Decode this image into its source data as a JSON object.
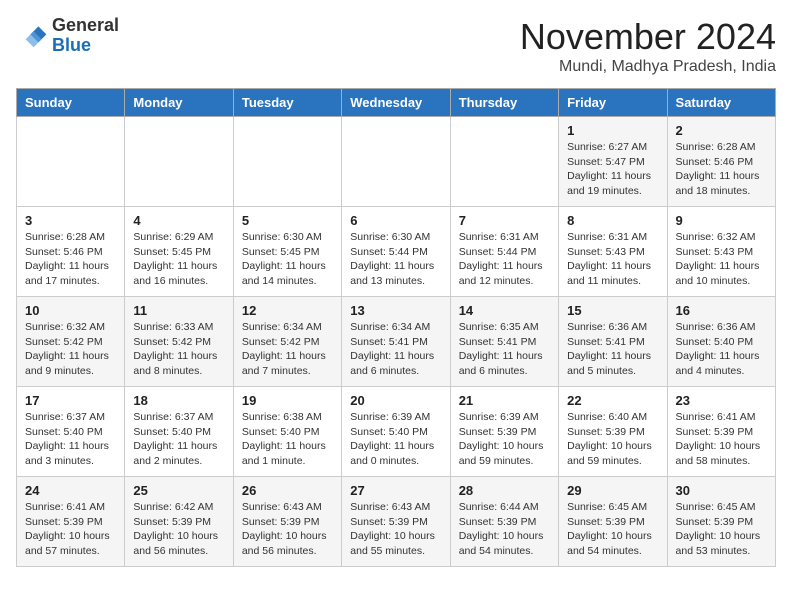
{
  "header": {
    "logo_general": "General",
    "logo_blue": "Blue",
    "month_title": "November 2024",
    "subtitle": "Mundi, Madhya Pradesh, India"
  },
  "days_of_week": [
    "Sunday",
    "Monday",
    "Tuesday",
    "Wednesday",
    "Thursday",
    "Friday",
    "Saturday"
  ],
  "weeks": [
    [
      {
        "day": "",
        "info": ""
      },
      {
        "day": "",
        "info": ""
      },
      {
        "day": "",
        "info": ""
      },
      {
        "day": "",
        "info": ""
      },
      {
        "day": "",
        "info": ""
      },
      {
        "day": "1",
        "info": "Sunrise: 6:27 AM\nSunset: 5:47 PM\nDaylight: 11 hours and 19 minutes."
      },
      {
        "day": "2",
        "info": "Sunrise: 6:28 AM\nSunset: 5:46 PM\nDaylight: 11 hours and 18 minutes."
      }
    ],
    [
      {
        "day": "3",
        "info": "Sunrise: 6:28 AM\nSunset: 5:46 PM\nDaylight: 11 hours and 17 minutes."
      },
      {
        "day": "4",
        "info": "Sunrise: 6:29 AM\nSunset: 5:45 PM\nDaylight: 11 hours and 16 minutes."
      },
      {
        "day": "5",
        "info": "Sunrise: 6:30 AM\nSunset: 5:45 PM\nDaylight: 11 hours and 14 minutes."
      },
      {
        "day": "6",
        "info": "Sunrise: 6:30 AM\nSunset: 5:44 PM\nDaylight: 11 hours and 13 minutes."
      },
      {
        "day": "7",
        "info": "Sunrise: 6:31 AM\nSunset: 5:44 PM\nDaylight: 11 hours and 12 minutes."
      },
      {
        "day": "8",
        "info": "Sunrise: 6:31 AM\nSunset: 5:43 PM\nDaylight: 11 hours and 11 minutes."
      },
      {
        "day": "9",
        "info": "Sunrise: 6:32 AM\nSunset: 5:43 PM\nDaylight: 11 hours and 10 minutes."
      }
    ],
    [
      {
        "day": "10",
        "info": "Sunrise: 6:32 AM\nSunset: 5:42 PM\nDaylight: 11 hours and 9 minutes."
      },
      {
        "day": "11",
        "info": "Sunrise: 6:33 AM\nSunset: 5:42 PM\nDaylight: 11 hours and 8 minutes."
      },
      {
        "day": "12",
        "info": "Sunrise: 6:34 AM\nSunset: 5:42 PM\nDaylight: 11 hours and 7 minutes."
      },
      {
        "day": "13",
        "info": "Sunrise: 6:34 AM\nSunset: 5:41 PM\nDaylight: 11 hours and 6 minutes."
      },
      {
        "day": "14",
        "info": "Sunrise: 6:35 AM\nSunset: 5:41 PM\nDaylight: 11 hours and 6 minutes."
      },
      {
        "day": "15",
        "info": "Sunrise: 6:36 AM\nSunset: 5:41 PM\nDaylight: 11 hours and 5 minutes."
      },
      {
        "day": "16",
        "info": "Sunrise: 6:36 AM\nSunset: 5:40 PM\nDaylight: 11 hours and 4 minutes."
      }
    ],
    [
      {
        "day": "17",
        "info": "Sunrise: 6:37 AM\nSunset: 5:40 PM\nDaylight: 11 hours and 3 minutes."
      },
      {
        "day": "18",
        "info": "Sunrise: 6:37 AM\nSunset: 5:40 PM\nDaylight: 11 hours and 2 minutes."
      },
      {
        "day": "19",
        "info": "Sunrise: 6:38 AM\nSunset: 5:40 PM\nDaylight: 11 hours and 1 minute."
      },
      {
        "day": "20",
        "info": "Sunrise: 6:39 AM\nSunset: 5:40 PM\nDaylight: 11 hours and 0 minutes."
      },
      {
        "day": "21",
        "info": "Sunrise: 6:39 AM\nSunset: 5:39 PM\nDaylight: 10 hours and 59 minutes."
      },
      {
        "day": "22",
        "info": "Sunrise: 6:40 AM\nSunset: 5:39 PM\nDaylight: 10 hours and 59 minutes."
      },
      {
        "day": "23",
        "info": "Sunrise: 6:41 AM\nSunset: 5:39 PM\nDaylight: 10 hours and 58 minutes."
      }
    ],
    [
      {
        "day": "24",
        "info": "Sunrise: 6:41 AM\nSunset: 5:39 PM\nDaylight: 10 hours and 57 minutes."
      },
      {
        "day": "25",
        "info": "Sunrise: 6:42 AM\nSunset: 5:39 PM\nDaylight: 10 hours and 56 minutes."
      },
      {
        "day": "26",
        "info": "Sunrise: 6:43 AM\nSunset: 5:39 PM\nDaylight: 10 hours and 56 minutes."
      },
      {
        "day": "27",
        "info": "Sunrise: 6:43 AM\nSunset: 5:39 PM\nDaylight: 10 hours and 55 minutes."
      },
      {
        "day": "28",
        "info": "Sunrise: 6:44 AM\nSunset: 5:39 PM\nDaylight: 10 hours and 54 minutes."
      },
      {
        "day": "29",
        "info": "Sunrise: 6:45 AM\nSunset: 5:39 PM\nDaylight: 10 hours and 54 minutes."
      },
      {
        "day": "30",
        "info": "Sunrise: 6:45 AM\nSunset: 5:39 PM\nDaylight: 10 hours and 53 minutes."
      }
    ]
  ]
}
